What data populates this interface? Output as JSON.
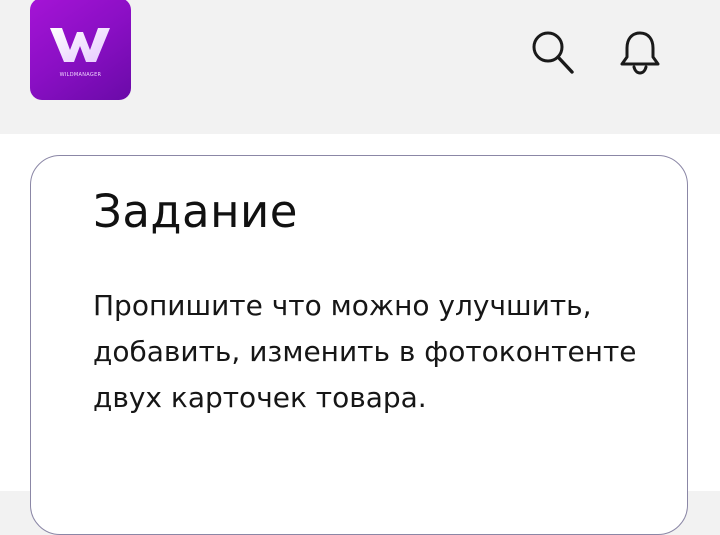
{
  "header": {
    "logo_text": "WILDMANAGER",
    "icons": {
      "search": "search-icon",
      "notifications": "bell-icon"
    }
  },
  "colors": {
    "brand_purple": "#9a12d0",
    "header_bg": "#f2f2f2",
    "card_border": "#8b87a6",
    "text": "#111111"
  },
  "task": {
    "title": "Задание",
    "description": "Пропишите что можно улучшить, добавить, изменить в фотоконтенте двух карточек товара."
  }
}
